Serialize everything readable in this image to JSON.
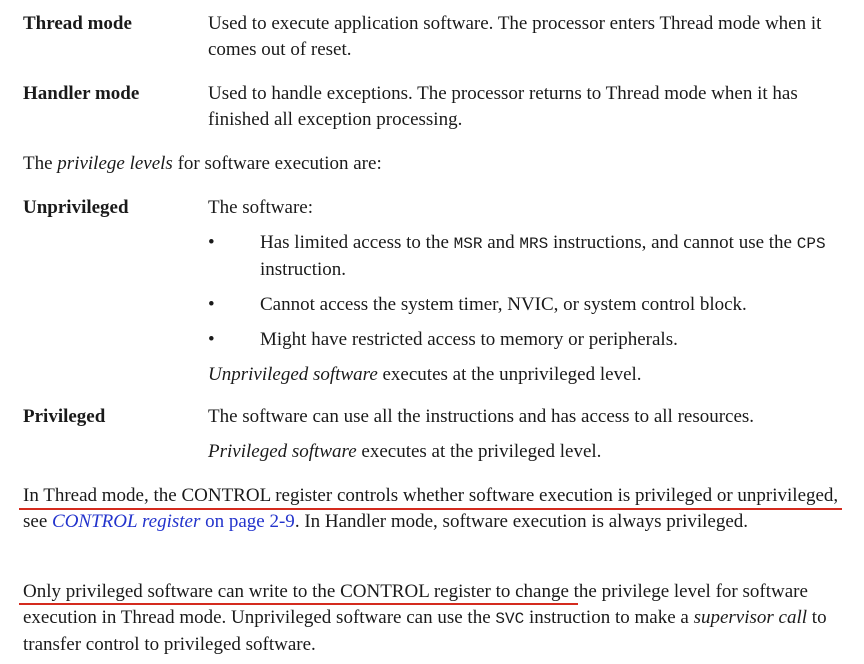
{
  "modes": [
    {
      "term": "Thread mode",
      "desc": "Used to execute application software. The processor enters Thread mode when it comes out of reset."
    },
    {
      "term": "Handler mode",
      "desc": "Used to handle exceptions. The processor returns to Thread mode when it has finished all exception processing."
    }
  ],
  "privilege_intro": {
    "before": "The ",
    "italic": "privilege levels",
    "after": " for software execution are:"
  },
  "unprivileged": {
    "term": "Unprivileged",
    "lead": "The software:",
    "bullet_char": "•",
    "bullet1": {
      "a": "Has limited access to the ",
      "code1": "MSR",
      "b": " and ",
      "code2": "MRS",
      "c": " instructions, and cannot use the ",
      "code3": "CPS",
      "d": " instruction."
    },
    "bullet2": "Cannot access the system timer, NVIC, or system control block.",
    "bullet3": "Might have restricted access to memory or peripherals.",
    "closing_italic": "Unprivileged software",
    "closing_rest": " executes at the unprivileged level."
  },
  "privileged": {
    "term": "Privileged",
    "desc": "The software can use all the instructions and has access to all resources.",
    "closing_italic": "Privileged software",
    "closing_rest": " executes at the privileged level."
  },
  "control_para": {
    "a": "In Thread mode, the CONTROL register controls whether software execution is privileged or unprivileged, see ",
    "link": "CONTROL register",
    "link_page": " on page 2-9",
    "b": ". In Handler mode, software execution is always privileged."
  },
  "write_para": {
    "a": "Only privileged software can write to the CONTROL register to change the privilege level for software execution in Thread mode. Unprivileged software can use the ",
    "code": "SVC",
    "b": " instruction to make a ",
    "italic": "supervisor call",
    "c": " to transfer control to privileged software."
  },
  "colors": {
    "underline": "#d42b1e",
    "link": "#2233cc"
  }
}
